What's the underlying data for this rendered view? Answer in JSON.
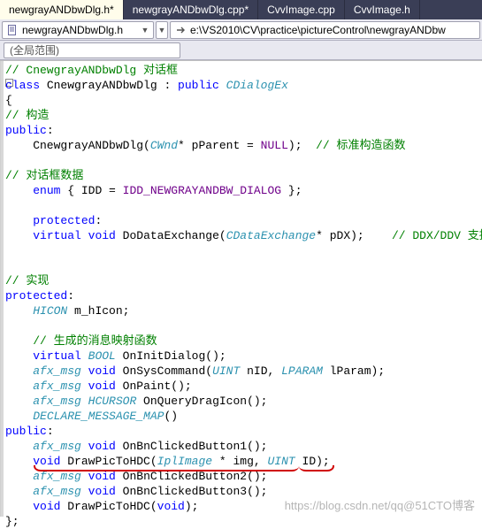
{
  "tabs": [
    {
      "label": "newgrayANDbwDlg.h*",
      "active": true
    },
    {
      "label": "newgrayANDbwDlg.cpp*",
      "active": false
    },
    {
      "label": "CvvImage.cpp",
      "active": false
    },
    {
      "label": "CvvImage.h",
      "active": false
    }
  ],
  "nav": {
    "file": "newgrayANDbwDlg.h",
    "path": "e:\\VS2010\\CV\\practice\\pictureControl\\newgrayANDbw"
  },
  "scope": {
    "label": "(全局范围)"
  },
  "code_lines": [
    [
      [
        "comment",
        "// CnewgrayANDbwDlg 对话框"
      ]
    ],
    [
      [
        "keyword",
        "class"
      ],
      [
        "plain",
        " CnewgrayANDbwDlg : "
      ],
      [
        "keyword",
        "public"
      ],
      [
        "plain",
        " "
      ],
      [
        "type",
        "CDialogEx"
      ]
    ],
    [
      [
        "plain",
        "{"
      ]
    ],
    [
      [
        "comment",
        "// 构造"
      ]
    ],
    [
      [
        "keyword",
        "public"
      ],
      [
        "plain",
        ":"
      ]
    ],
    [
      [
        "plain",
        "    CnewgrayANDbwDlg("
      ],
      [
        "type",
        "CWnd"
      ],
      [
        "plain",
        "* pParent = "
      ],
      [
        "macro",
        "NULL"
      ],
      [
        "plain",
        ");  "
      ],
      [
        "comment",
        "// 标准构造函数"
      ]
    ],
    [
      [
        "plain",
        ""
      ]
    ],
    [
      [
        "comment",
        "// 对话框数据"
      ]
    ],
    [
      [
        "plain",
        "    "
      ],
      [
        "keyword",
        "enum"
      ],
      [
        "plain",
        " { IDD = "
      ],
      [
        "macro",
        "IDD_NEWGRAYANDBW_DIALOG"
      ],
      [
        "plain",
        " };"
      ]
    ],
    [
      [
        "plain",
        ""
      ]
    ],
    [
      [
        "plain",
        "    "
      ],
      [
        "keyword",
        "protected"
      ],
      [
        "plain",
        ":"
      ]
    ],
    [
      [
        "plain",
        "    "
      ],
      [
        "keyword",
        "virtual"
      ],
      [
        "plain",
        " "
      ],
      [
        "keyword",
        "void"
      ],
      [
        "plain",
        " DoDataExchange("
      ],
      [
        "type",
        "CDataExchange"
      ],
      [
        "plain",
        "* pDX);    "
      ],
      [
        "comment",
        "// DDX/DDV 支持"
      ]
    ],
    [
      [
        "plain",
        ""
      ]
    ],
    [
      [
        "plain",
        ""
      ]
    ],
    [
      [
        "comment",
        "// 实现"
      ]
    ],
    [
      [
        "keyword",
        "protected"
      ],
      [
        "plain",
        ":"
      ]
    ],
    [
      [
        "plain",
        "    "
      ],
      [
        "type",
        "HICON"
      ],
      [
        "plain",
        " m_hIcon;"
      ]
    ],
    [
      [
        "plain",
        ""
      ]
    ],
    [
      [
        "plain",
        "    "
      ],
      [
        "comment",
        "// 生成的消息映射函数"
      ]
    ],
    [
      [
        "plain",
        "    "
      ],
      [
        "keyword",
        "virtual"
      ],
      [
        "plain",
        " "
      ],
      [
        "type",
        "BOOL"
      ],
      [
        "plain",
        " OnInitDialog();"
      ]
    ],
    [
      [
        "plain",
        "    "
      ],
      [
        "type",
        "afx_msg"
      ],
      [
        "plain",
        " "
      ],
      [
        "keyword",
        "void"
      ],
      [
        "plain",
        " OnSysCommand("
      ],
      [
        "type",
        "UINT"
      ],
      [
        "plain",
        " nID, "
      ],
      [
        "type",
        "LPARAM"
      ],
      [
        "plain",
        " lParam);"
      ]
    ],
    [
      [
        "plain",
        "    "
      ],
      [
        "type",
        "afx_msg"
      ],
      [
        "plain",
        " "
      ],
      [
        "keyword",
        "void"
      ],
      [
        "plain",
        " OnPaint();"
      ]
    ],
    [
      [
        "plain",
        "    "
      ],
      [
        "type",
        "afx_msg"
      ],
      [
        "plain",
        " "
      ],
      [
        "type",
        "HCURSOR"
      ],
      [
        "plain",
        " OnQueryDragIcon();"
      ]
    ],
    [
      [
        "plain",
        "    "
      ],
      [
        "type",
        "DECLARE_MESSAGE_MAP"
      ],
      [
        "plain",
        "()"
      ]
    ],
    [
      [
        "keyword",
        "public"
      ],
      [
        "plain",
        ":"
      ]
    ],
    [
      [
        "plain",
        "    "
      ],
      [
        "type",
        "afx_msg"
      ],
      [
        "plain",
        " "
      ],
      [
        "keyword",
        "void"
      ],
      [
        "plain",
        " OnBnClickedButton1();"
      ]
    ],
    [
      [
        "plain",
        "    "
      ],
      [
        "keyword",
        "void"
      ],
      [
        "plain",
        " DrawPicToHDC("
      ],
      [
        "type",
        "IplImage"
      ],
      [
        "plain",
        " * img, "
      ],
      [
        "type",
        "UINT"
      ],
      [
        "plain",
        " ID);"
      ]
    ],
    [
      [
        "plain",
        "    "
      ],
      [
        "type",
        "afx_msg"
      ],
      [
        "plain",
        " "
      ],
      [
        "keyword",
        "void"
      ],
      [
        "plain",
        " OnBnClickedButton2();"
      ]
    ],
    [
      [
        "plain",
        "    "
      ],
      [
        "type",
        "afx_msg"
      ],
      [
        "plain",
        " "
      ],
      [
        "keyword",
        "void"
      ],
      [
        "plain",
        " OnBnClickedButton3();"
      ]
    ],
    [
      [
        "plain",
        "    "
      ],
      [
        "keyword",
        "void"
      ],
      [
        "plain",
        " DrawPicToHDC("
      ],
      [
        "keyword",
        "void"
      ],
      [
        "plain",
        ");"
      ]
    ],
    [
      [
        "plain",
        "};"
      ]
    ]
  ],
  "watermark": "https://blog.csdn.net/qq@51CTO博客"
}
